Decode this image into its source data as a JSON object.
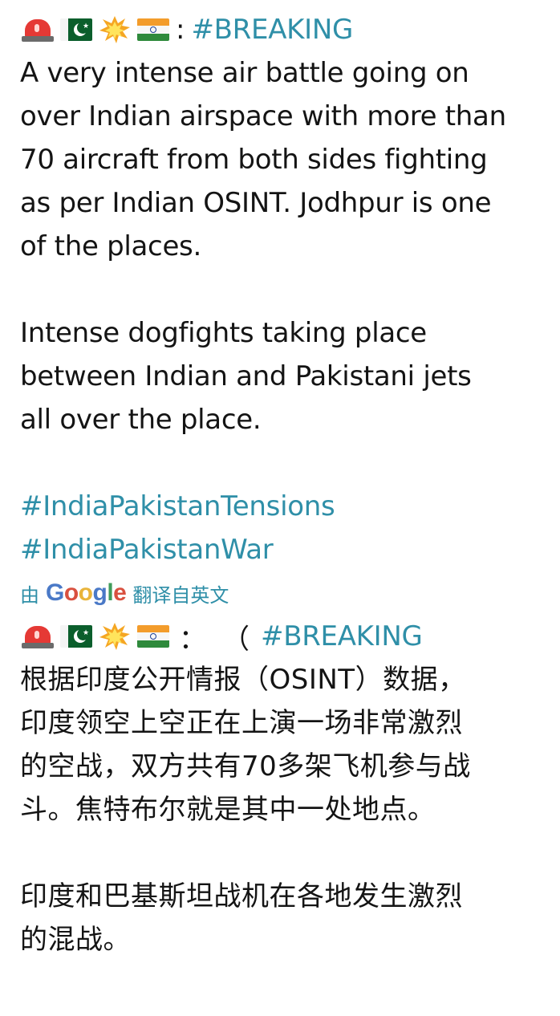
{
  "post_en": {
    "emoji_icons": [
      "police-light-icon",
      "pakistan-flag-icon",
      "collision-icon",
      "india-flag-icon"
    ],
    "colon": ":",
    "hashtag_breaking": "#BREAKING",
    "lines": [
      "A very intense air battle going on",
      "over Indian airspace with more than",
      "70 aircraft from both sides fighting",
      "as per Indian OSINT. Jodhpur is one",
      "of the places."
    ],
    "lines2": [
      "Intense dogfights taking place",
      "between Indian and Pakistani jets",
      "all over the place."
    ],
    "hashtags": [
      "#IndiaPakistanTensions",
      "#IndiaPakistanWar"
    ]
  },
  "translation_bar": {
    "prefix": "由",
    "google_letters": [
      "G",
      "o",
      "o",
      "g",
      "l",
      "e"
    ],
    "suffix": "翻译自英文"
  },
  "post_cn": {
    "colon": "：",
    "paren": "（",
    "hashtag_breaking": "#BREAKING",
    "lines": [
      "根据印度公开情报（OSINT）数据，",
      "印度领空上空正在上演一场非常激烈",
      "的空战，双方共有70多架飞机参与战",
      "斗。焦特布尔就是其中一处地点。"
    ],
    "lines2": [
      "印度和巴基斯坦战机在各地发生激烈",
      "的混战。"
    ]
  },
  "colors": {
    "link": "#2f8fa8",
    "text": "#141414",
    "background": "#ffffff"
  }
}
